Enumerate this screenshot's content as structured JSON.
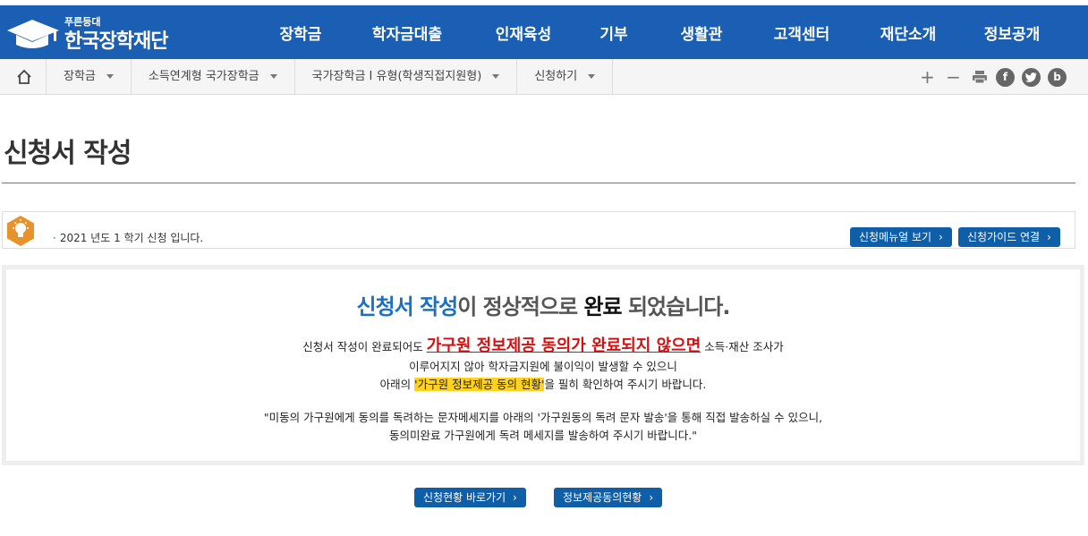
{
  "header": {
    "logo_small": "푸른등대",
    "logo_main": "한국장학재단",
    "nav": [
      "장학금",
      "학자금대출",
      "인재육성",
      "기부",
      "생활관",
      "고객센터",
      "재단소개",
      "정보공개"
    ]
  },
  "breadcrumb": {
    "items": [
      "장학금",
      "소득연계형 국가장학금",
      "국가장학금 I 유형(학생직접지원형)",
      "신청하기"
    ]
  },
  "utilities": [
    "plus-icon",
    "minus-icon",
    "print-icon",
    "facebook-icon",
    "twitter-icon",
    "blog-icon"
  ],
  "page": {
    "title": "신청서 작성"
  },
  "notice": {
    "text": "2021 년도 1 학기 신청 입니다.",
    "manual_button": "신청메뉴얼 보기",
    "guide_button": "신청가이드 연결"
  },
  "result": {
    "head_blue": "신청서 작성",
    "head_mid": "이 정상적으로 ",
    "head_black": "완료",
    "head_end": " 되었습니다.",
    "line1_pre": "신청서 작성이 완료되어도 ",
    "line1_red": "가구원 정보제공 동의가 완료되지 않으면",
    "line1_post": " 소득·재산 조사가",
    "line2": "이루어지지 않아 학자금지원에 불이익이 발생할 수 있으니",
    "line3_pre": "아래의 ",
    "line3_hl": "'가구원 정보제공 동의 현황'",
    "line3_post": "을 필히 확인하여 주시기 바랍니다.",
    "line4": "\"미동의 가구원에게 동의를 독려하는 문자메세지를 아래의 '가구원동의 독려 문자 발송'을 통해 직접 발송하실 수 있으니,",
    "line5": "동의미완료 가구원에게 독려 메세지를 발송하여 주시기 바랍니다.\""
  },
  "actions": {
    "status_button": "신청현황 바로가기",
    "consent_button": "정보제공동의현황"
  },
  "colors": {
    "brand_blue": "#1a5fb4",
    "button_blue": "#0f5ea8",
    "alert_red": "#d51010",
    "highlight_yellow": "#ffd21f"
  }
}
